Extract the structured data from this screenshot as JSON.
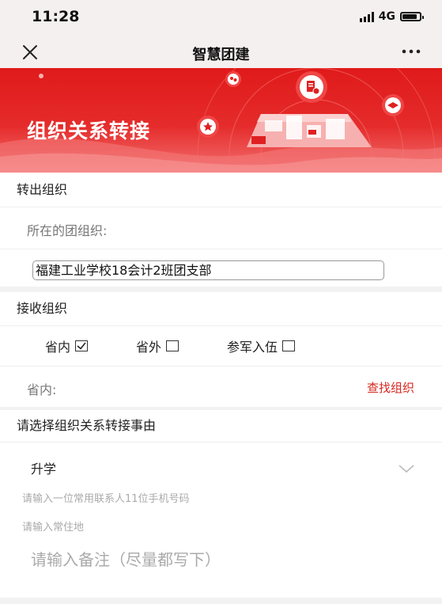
{
  "status_bar": {
    "time": "11:28",
    "network": "4G"
  },
  "nav": {
    "title": "智慧团建",
    "close_icon": "close-icon",
    "more_icon": "more-dots-icon"
  },
  "banner": {
    "heading": "组织关系转接",
    "colors": {
      "top": "#e01a1a",
      "bottom": "#f36f6f"
    }
  },
  "transfer_out": {
    "section_title": "转出组织",
    "org_label": "所在的团组织:",
    "org_value": "福建工业学校18会计2班团支部"
  },
  "receive": {
    "section_title": "接收组织",
    "options": [
      {
        "label": "省内",
        "checked": true
      },
      {
        "label": "省外",
        "checked": false
      },
      {
        "label": "参军入伍",
        "checked": false
      }
    ],
    "province_label": "省内:",
    "find_link": "查找组织"
  },
  "reason": {
    "section_title": "请选择组织关系转接事由",
    "selected": "升学",
    "phone_placeholder": "请输入一位常用联系人11位手机号码",
    "address_placeholder": "请输入常住地",
    "note_placeholder": "请输入备注（尽量都写下）"
  },
  "accent_color": "#d6281f"
}
